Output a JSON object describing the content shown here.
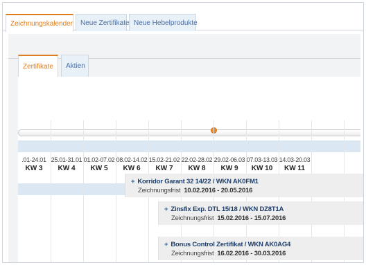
{
  "top_tabs": [
    {
      "label": "Zeichnungskalender",
      "active": true
    },
    {
      "label": "Neue Zertifikate",
      "active": false
    },
    {
      "label": "Neue Hebelprodukte",
      "active": false
    }
  ],
  "sub_tabs": [
    {
      "label": "Zertifikate",
      "active": true
    },
    {
      "label": "Aktien",
      "active": false
    }
  ],
  "slider": {
    "value_fraction": 0.57
  },
  "weeks": [
    {
      "dates": ".01-24.01",
      "kw": "KW 3"
    },
    {
      "dates": "25.01-31.01",
      "kw": "KW 4"
    },
    {
      "dates": "01.02-07.02",
      "kw": "KW 5"
    },
    {
      "dates": "08.02-14.02",
      "kw": "KW 6"
    },
    {
      "dates": "15.02-21.02",
      "kw": "KW 7"
    },
    {
      "dates": "22.02-28.02",
      "kw": "KW 8"
    },
    {
      "dates": "29.02-06.03",
      "kw": "KW 9"
    },
    {
      "dates": "07.03-13.03",
      "kw": "KW 10"
    },
    {
      "dates": "14.03-20.03",
      "kw": "KW 11"
    }
  ],
  "events": [
    {
      "plus": "+",
      "title": "Korridor Garant 32 14/22 / WKN AK0FM1",
      "frist_label": "Zeichnungsfrist",
      "frist_value": "10.02.2016 - 20.05.2016"
    },
    {
      "plus": "+",
      "title": "Zinsfix Exp. DTL 15/18 / WKN DZ8T1A",
      "frist_label": "Zeichnungsfrist",
      "frist_value": "15.02.2016 - 15.07.2016"
    },
    {
      "plus": "+",
      "title": "Bonus Control Zertifikat / WKN AK0AG4",
      "frist_label": "Zeichnungsfrist",
      "frist_value": "16.02.2016 - 30.03.2016"
    }
  ],
  "colors": {
    "accent": "#e07b1a",
    "link": "#4a6fa5",
    "band": "#dbe8f3",
    "title": "#1f3f6b"
  }
}
